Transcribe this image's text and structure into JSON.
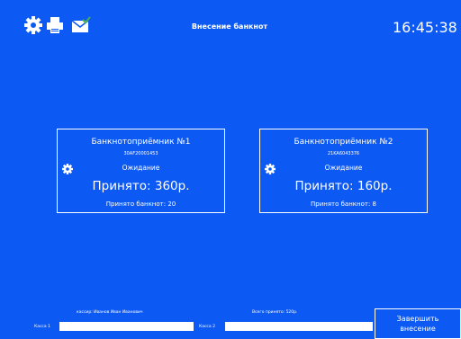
{
  "header": {
    "title": "Внесение банкнот",
    "time": "16:45:38",
    "icons": [
      "gear-icon",
      "printer-icon",
      "mail-icon"
    ]
  },
  "acceptors": [
    {
      "name": "Банкнотоприёмник №1",
      "serial": "30AF20001453",
      "status": "Ожидание",
      "accepted": "Принято: 360р.",
      "notes": "Принято банкнот: 20"
    },
    {
      "name": "Банкнотоприёмник №2",
      "serial": "21KA6043376",
      "status": "Ожидание",
      "accepted": "Принято: 160р.",
      "notes": "Принято банкнот: 8"
    }
  ],
  "footer": {
    "cashier": "кассир: Иванов Иван Иванович",
    "total": "Всего принято: 520р.",
    "kassa1_label": "Касса 1",
    "kassa1_value": "",
    "kassa2_label": "Касса 2",
    "kassa2_value": "",
    "finish_line1": "Завершить",
    "finish_line2": "внесение"
  },
  "colors": {
    "background": "#0d59f4",
    "foreground": "#ffffff",
    "mail_check": "#4caf50"
  }
}
